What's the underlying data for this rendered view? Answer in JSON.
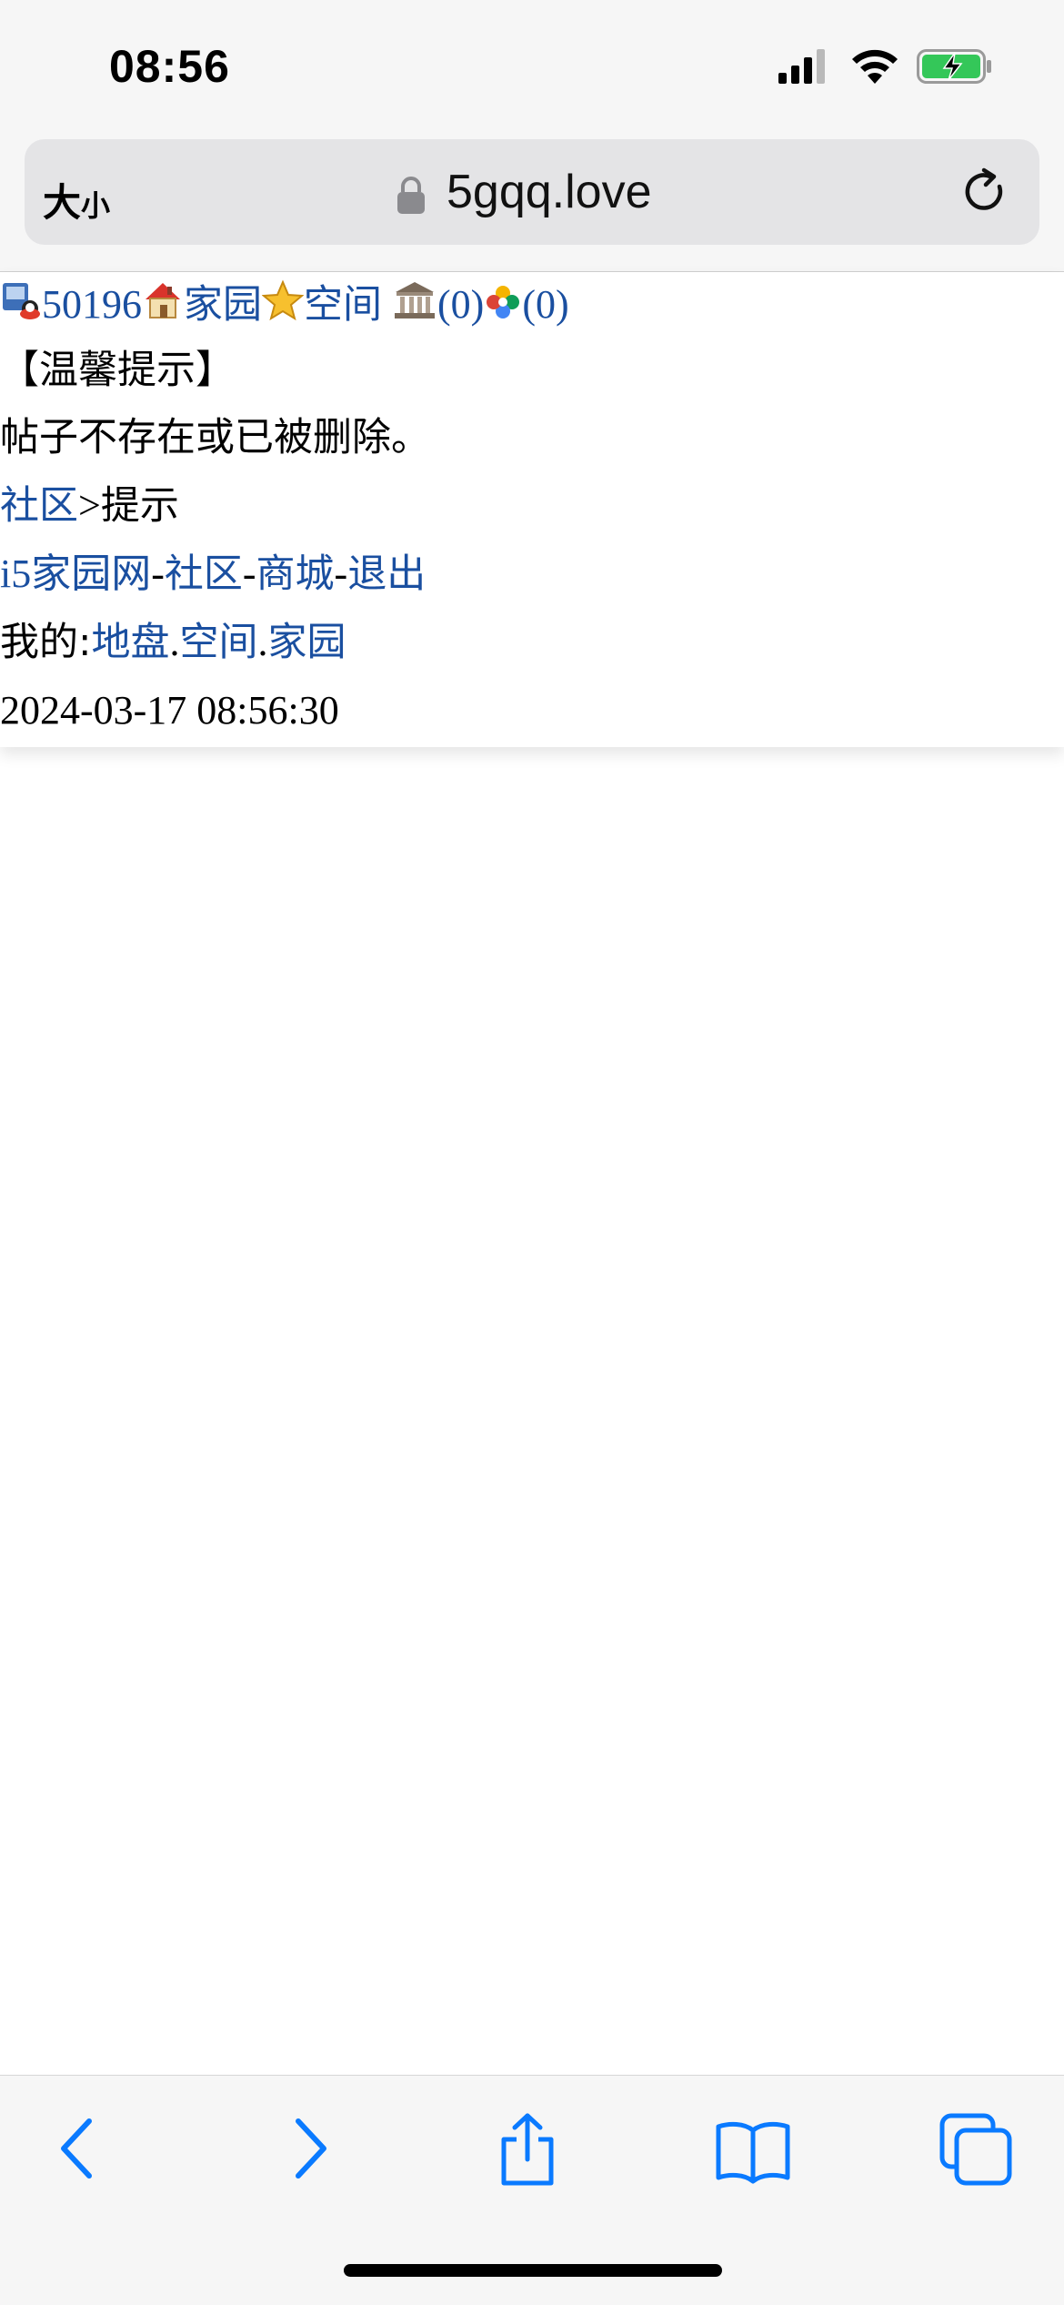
{
  "status_bar": {
    "time": "08:56",
    "icons": [
      "cellular-signal-icon",
      "wifi-icon",
      "battery-charging-icon"
    ],
    "battery_color": "#34c759"
  },
  "browser": {
    "text_size_label_big": "大",
    "text_size_label_small": "小",
    "domain": "5gqq.love",
    "icons": [
      "lock-icon",
      "reload-icon"
    ]
  },
  "page": {
    "userbar": {
      "user_id": "50196",
      "home_link": "家园",
      "space_link": "空间",
      "bank_count": "(0)",
      "photo_count": "(0)"
    },
    "notice_title": "【温馨提示】",
    "notice_message": "帖子不存在或已被删除。",
    "breadcrumb": {
      "link": "社区",
      "separator": ">",
      "current": "提示"
    },
    "footer_links": {
      "site": "i5家园网",
      "sep": "-",
      "community": "社区",
      "mall": "商城",
      "logout": "退出"
    },
    "mine": {
      "label": "我的:",
      "land": "地盘",
      "space": "空间",
      "home": "家园",
      "dot": "."
    },
    "timestamp": "2024-03-17 08:56:30"
  },
  "toolbar": {
    "items": [
      "back-icon",
      "forward-icon",
      "share-icon",
      "bookmarks-icon",
      "tabs-icon"
    ],
    "accent_color": "#0a7aff"
  },
  "colors": {
    "link": "#1a4fa0",
    "chrome_bg": "#f6f6f6",
    "urlbar_bg": "#e4e4e6"
  }
}
